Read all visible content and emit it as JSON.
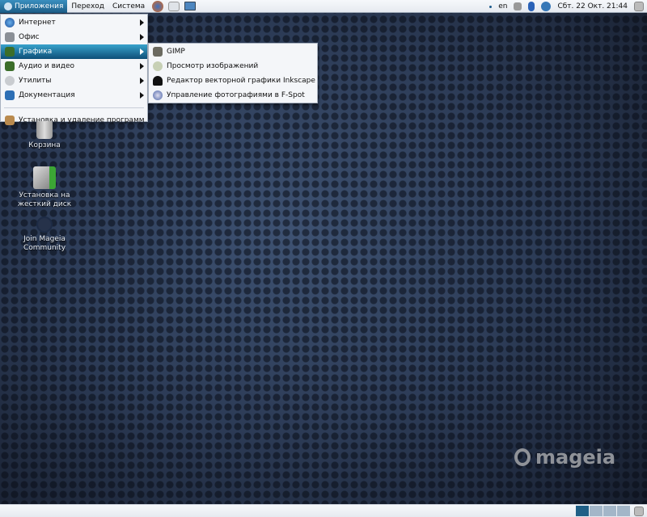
{
  "top_panel": {
    "menus": [
      "Приложения",
      "Переход",
      "Система"
    ],
    "launchers": [
      "firefox-icon",
      "mail-icon",
      "screenshot-icon"
    ],
    "tray": {
      "keyboard_layout": "en",
      "clock": "Сбт. 22 Окт. 21:44"
    }
  },
  "apps_menu": {
    "items": [
      {
        "label": "Интернет",
        "icon": "globe-icon",
        "submenu": true
      },
      {
        "label": "Офис",
        "icon": "office-icon",
        "submenu": true
      },
      {
        "label": "Графика",
        "icon": "graphics-icon",
        "submenu": true,
        "selected": true
      },
      {
        "label": "Аудио и видео",
        "icon": "multimedia-icon",
        "submenu": true
      },
      {
        "label": "Утилиты",
        "icon": "utilities-icon",
        "submenu": true
      },
      {
        "label": "Документация",
        "icon": "documentation-icon",
        "submenu": true
      }
    ],
    "footer_item": "Установка и удаление программ"
  },
  "graphics_submenu": {
    "items": [
      "GIMP",
      "Просмотр изображений",
      "Редактор векторной графики Inkscape",
      "Управление фотографиями в F-Spot"
    ]
  },
  "desktop_icons": [
    "Корзина",
    "Установка на жесткий диск",
    "Join Mageia Community"
  ],
  "logo_text": "mageia",
  "bottom_panel": {
    "workspaces": 4,
    "active_workspace": 1
  }
}
